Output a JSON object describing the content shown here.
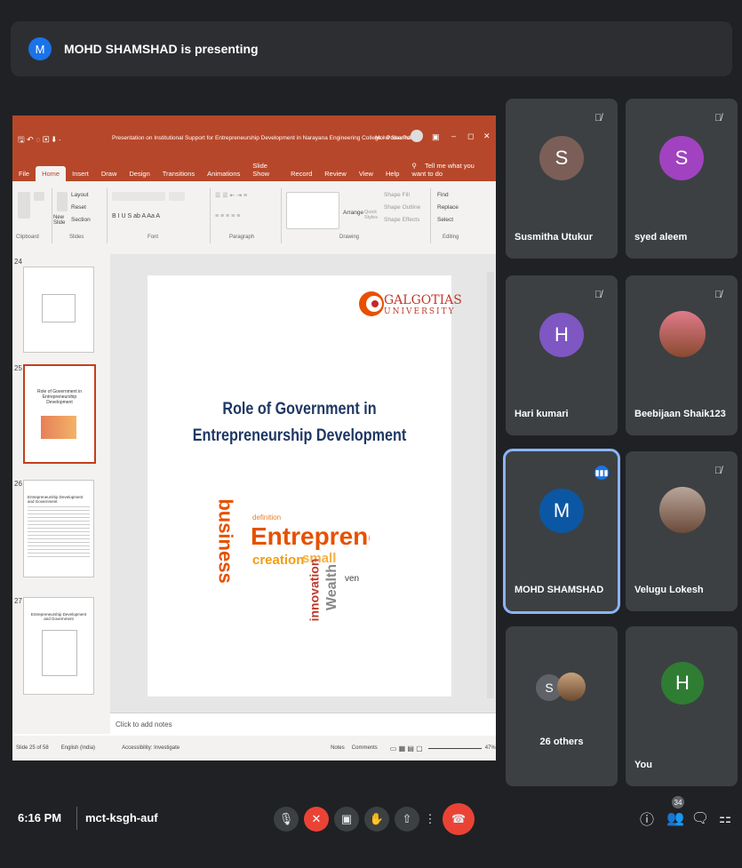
{
  "banner": {
    "avatar_letter": "M",
    "text": "MOHD SHAMSHAD is presenting"
  },
  "ppt": {
    "title": "Presentation on Institutional Support for Entrepreneurship Development in Narayana Engineering College  -  PowerPoint",
    "user": "Mohd Shamshad",
    "tabs": [
      "File",
      "Home",
      "Insert",
      "Draw",
      "Design",
      "Transitions",
      "Animations",
      "Slide Show",
      "Record",
      "Review",
      "View",
      "Help"
    ],
    "active_tab": "Home",
    "tellme": "Tell me what you want to do",
    "groups": [
      "Clipboard",
      "Slides",
      "Font",
      "Paragraph",
      "Drawing",
      "Editing"
    ],
    "slides_buttons": {
      "layout": "Layout",
      "reset": "Reset",
      "section": "Section",
      "new": "New Slide"
    },
    "editing": {
      "find": "Find",
      "replace": "Replace",
      "select": "Select"
    },
    "drawing": {
      "arrange": "Arrange",
      "quick_styles": "Quick Styles",
      "fill": "Shape Fill",
      "outline": "Shape Outline",
      "effects": "Shape Effects"
    },
    "thumbs": [
      {
        "num": "24"
      },
      {
        "num": "25",
        "selected": true
      },
      {
        "num": "26"
      },
      {
        "num": "27"
      }
    ],
    "thumb25_title": "Role of Government in Entrepreneurship Development",
    "thumb26_title": "Entrepreneurship Development and Government",
    "thumb27_title": "Entrepreneurship Development and Government",
    "slide": {
      "logo_line1": "GALGOTIAS",
      "logo_line2": "UNIVERSITY",
      "title_line1": "Role of Government in",
      "title_line2": "Entrepreneurship Development",
      "words": [
        "Entreprene",
        "business",
        "creation",
        "small",
        "innovation",
        "Wealth",
        "definition",
        "ven"
      ]
    },
    "notes_placeholder": "Click to add notes",
    "status": {
      "slide": "Slide 25 of 58",
      "lang": "English (India)",
      "accessibility": "Accessibility: Investigate",
      "notes": "Notes",
      "comments": "Comments",
      "zoom": "47%"
    }
  },
  "tiles": [
    {
      "name": "Susmitha Utukur",
      "letter": "S",
      "color": "#7b5e57"
    },
    {
      "name": "syed aleem",
      "letter": "S",
      "color": "#a142c0"
    },
    {
      "name": "Hari kumari",
      "letter": "H",
      "color": "#7e57c2"
    },
    {
      "name": "Beebijaan Shaik123",
      "letter": ""
    },
    {
      "name": "MOHD SHAMSHAD",
      "letter": "M",
      "color": "#0b57a4"
    },
    {
      "name": "Velugu Lokesh",
      "letter": ""
    },
    {
      "name": "26 others",
      "letter": "S"
    },
    {
      "name": "You",
      "letter": "H",
      "color": "#2e7d32"
    }
  ],
  "bottom": {
    "time": "6:16 PM",
    "meeting_code": "mct-ksgh-auf",
    "participants_count": "34"
  }
}
